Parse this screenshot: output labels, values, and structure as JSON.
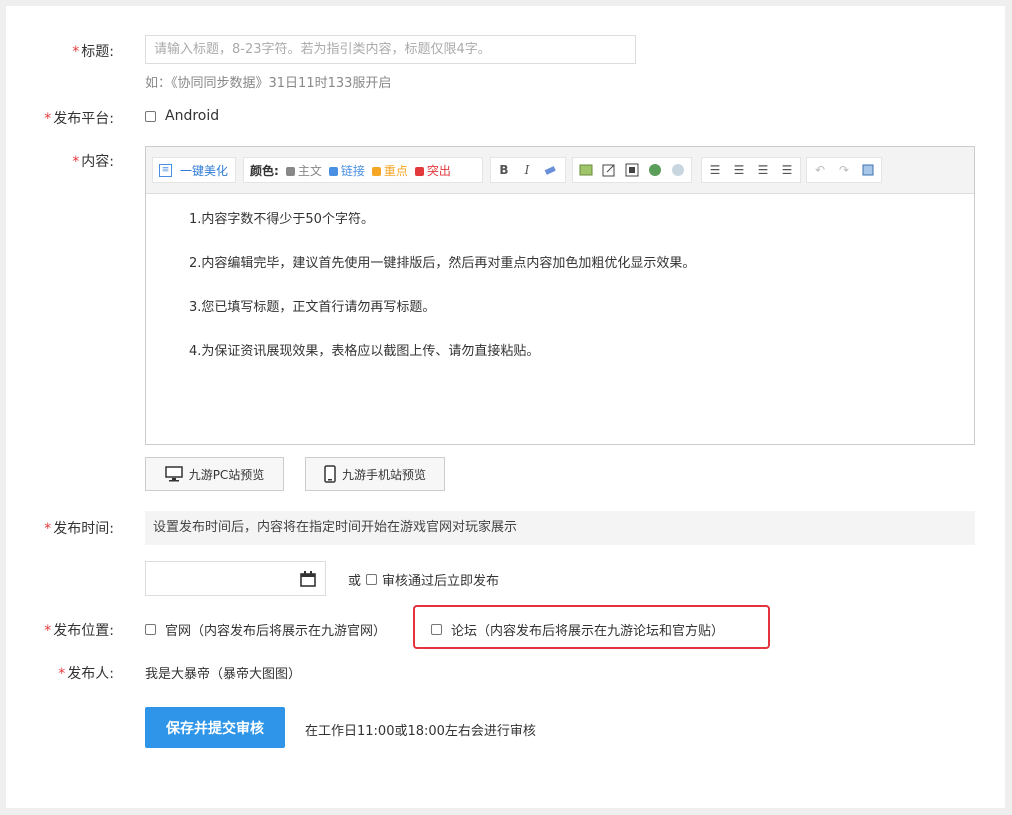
{
  "form": {
    "title": {
      "label": "标题:",
      "placeholder": "请输入标题，8-23字符。若为指引类内容，标题仅限4字。",
      "hint": "如：《协同同步数据》31日11时133服开启"
    },
    "platform": {
      "label": "发布平台:",
      "option": "Android"
    },
    "content": {
      "label": "内容:",
      "toolbar": {
        "beautify": "一键美化",
        "color_label": "颜色:",
        "colors": [
          {
            "name": "主文",
            "color": "#888888"
          },
          {
            "name": "链接",
            "color": "#4a90e2"
          },
          {
            "name": "重点",
            "color": "#f5a623"
          },
          {
            "name": "突出",
            "color": "#e4393c"
          }
        ]
      },
      "lines": [
        "1.内容字数不得少于50个字符。",
        "2.内容编辑完毕，建议首先使用一键排版后，然后再对重点内容加色加粗优化显示效果。",
        "3.您已填写标题，正文首行请勿再写标题。",
        "4.为保证资讯展现效果，表格应以截图上传、请勿直接粘贴。"
      ],
      "preview_pc": "九游PC站预览",
      "preview_mobile": "九游手机站预览"
    },
    "time": {
      "label": "发布时间:",
      "note": "设置发布时间后，内容将在指定时间开始在游戏官网对玩家展示",
      "or": "或",
      "immediate": "审核通过后立即发布"
    },
    "position": {
      "label": "发布位置:",
      "official": "官网（内容发布后将展示在九游官网）",
      "forum": "论坛（内容发布后将展示在九游论坛和官方贴）"
    },
    "publisher": {
      "label": "发布人:",
      "value": "我是大暴帝（暴帝大图图）"
    },
    "submit": {
      "label": "保存并提交审核",
      "note": "在工作日11:00或18:00左右会进行审核"
    }
  },
  "colors": {
    "required": "#e4393c",
    "primary": "#2e95e8",
    "highlight_border": "#e5333d"
  }
}
